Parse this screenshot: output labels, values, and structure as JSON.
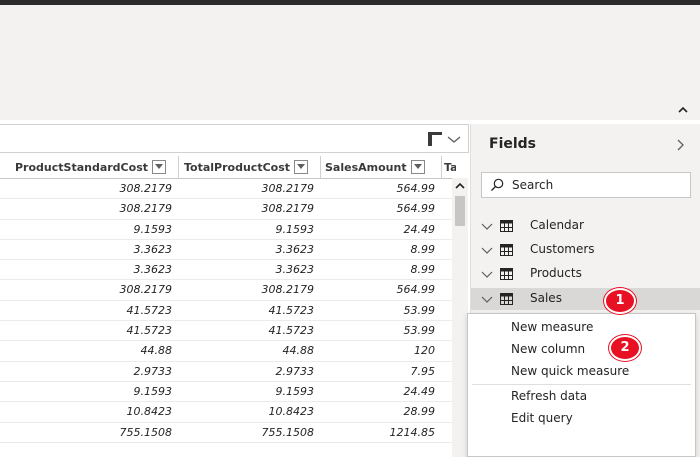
{
  "grid": {
    "columns": [
      "ProductStandardCost",
      "TotalProductCost",
      "SalesAmount",
      "TaxA"
    ],
    "rows": [
      [
        "308.2179",
        "308.2179",
        "564.99"
      ],
      [
        "308.2179",
        "308.2179",
        "564.99"
      ],
      [
        "9.1593",
        "9.1593",
        "24.49"
      ],
      [
        "3.3623",
        "3.3623",
        "8.99"
      ],
      [
        "3.3623",
        "3.3623",
        "8.99"
      ],
      [
        "308.2179",
        "308.2179",
        "564.99"
      ],
      [
        "41.5723",
        "41.5723",
        "53.99"
      ],
      [
        "41.5723",
        "41.5723",
        "53.99"
      ],
      [
        "44.88",
        "44.88",
        "120"
      ],
      [
        "2.9733",
        "2.9733",
        "7.95"
      ],
      [
        "9.1593",
        "9.1593",
        "24.49"
      ],
      [
        "10.8423",
        "10.8423",
        "28.99"
      ],
      [
        "755.1508",
        "755.1508",
        "1214.85"
      ]
    ]
  },
  "fields": {
    "title": "Fields",
    "search_placeholder": "Search",
    "tables": [
      "Calendar",
      "Customers",
      "Products",
      "Sales"
    ]
  },
  "context_menu": {
    "items": [
      "New measure",
      "New column",
      "New quick measure",
      "Refresh data",
      "Edit query"
    ]
  },
  "badges": [
    "1",
    "2"
  ],
  "colors": {
    "ribbon": "#f3f2f1",
    "pane": "#f3f2f1",
    "selected_row": "#d9d8d6",
    "badge": "#e81123"
  }
}
